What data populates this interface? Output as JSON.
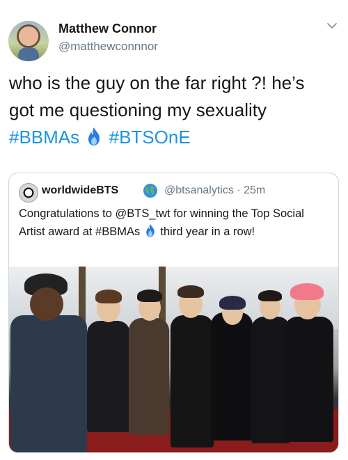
{
  "tweet": {
    "author_name": "Matthew Connor",
    "author_handle": "@matthewconnnor",
    "text_line1": "who is the guy on the far right ?! he’s",
    "text_line2": "got me questioning my sexuality",
    "hashtag1": "#BBMAs",
    "hashtag2": "#BTSOnE",
    "icons": [
      "avatar",
      "chevron-down-icon",
      "fire-icon"
    ],
    "hashtag_color": "#1b95e0"
  },
  "quoted_tweet": {
    "author_name": "worldwideBTS",
    "author_handle": "@btsanalytics",
    "separator": "·",
    "time_ago": "25m",
    "text_part1": "Congratulations to @BTS_twt for winning the Top Social Artist award at #BBMAs",
    "text_part2": " third year in a row!",
    "icons": [
      "globe-emoji-icon",
      "fire-icon"
    ]
  }
}
